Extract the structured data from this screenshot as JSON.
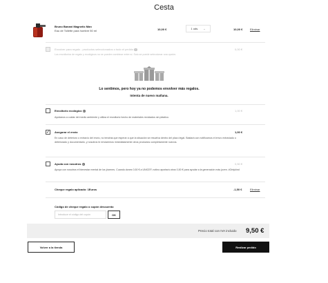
{
  "page_title": "Cesta",
  "product": {
    "name": "Bruno Banani Magnetic Man",
    "subtitle": "Eau de Toilette para hombre 50 ml",
    "unit_price": "10,00 €",
    "quantity": "1 uds.",
    "total": "10,00 €",
    "remove_label": "Eliminar"
  },
  "gift_wrap": {
    "label": "Envolver para regalo - productos seleccionados o todo el pedido",
    "price": "0,00 €",
    "description": "Los envoltorios de regalo y ecológicos no se pueden combinar entre sí. Solo se puede seleccionar una opción.",
    "icon": "gift-boxes",
    "sorry_title": "Lo sentimos, pero hoy ya no podemos envolver más regalos.",
    "sorry_sub": "Intenta de nuevo mañana."
  },
  "options": [
    {
      "title": "Envoltorio ecológico",
      "price": "1,00 €",
      "checked": false,
      "description": "Ayúdanos a cuidar del medio ambiente y utiliza el envoltorio hecho de materiales reciclados sin plástico."
    },
    {
      "title": "Asegurar el envío",
      "price": "1,00 €",
      "checked": true,
      "description": "En caso de deterioro o extravío del envío, no tendrás que esperar a que la situación se resuelva dentro del plazo legal. Bastará con notificarnos el envío extraviado o deteriorado y documentarlo, y nosotros te enviaremos inmediatamente otros productos completamente nuevos."
    },
    {
      "title": "Ayuda con nosotros",
      "price": "0,50 €",
      "checked": false,
      "description": "Apoya con nosotros el bienestar mental de los jóvenes. Cuando dones 0,50 € a UNICEF, notino aportará otros 0,50 € para ayudar a la generación más joven. #Onlykind"
    }
  ],
  "voucher": {
    "applied_label": "Cheque regalo aplicado: 1Euros",
    "amount": "-1,50 €",
    "remove_label": "Eliminar",
    "code_label": "Código de cheque regalo o cupón descuento",
    "code_placeholder": "Introduce el código del cupón",
    "ok_label": "OK"
  },
  "summary": {
    "total_label": "Precio total con IVA incluido",
    "total_value": "9,50 €"
  },
  "actions": {
    "back_label": "Volver a la tienda",
    "order_label": "Realizar pedido"
  },
  "colors": {
    "accent": "#111111",
    "muted": "#b8b8b8",
    "band": "#efefef"
  }
}
